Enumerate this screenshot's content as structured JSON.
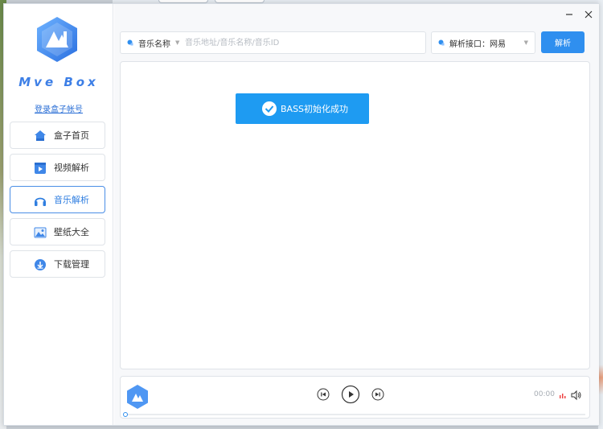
{
  "app": {
    "brand": "Mve Box",
    "login_link": "登录盒子帐号"
  },
  "sidebar": {
    "items": [
      {
        "label": "盒子首页",
        "icon": "home-icon",
        "active": false
      },
      {
        "label": "视频解析",
        "icon": "video-icon",
        "active": false
      },
      {
        "label": "音乐解析",
        "icon": "headphones-icon",
        "active": true
      },
      {
        "label": "壁纸大全",
        "icon": "image-icon",
        "active": false
      },
      {
        "label": "下载管理",
        "icon": "download-icon",
        "active": false
      }
    ]
  },
  "toolbar": {
    "search_type": "音乐名称",
    "search_placeholder": "音乐地址/音乐名称/音乐ID",
    "search_value": "",
    "interface_label": "解析接口：网易",
    "parse_button": "解析"
  },
  "toast": {
    "message": "BASS初始化成功"
  },
  "player": {
    "time": "00:00",
    "progress": 0
  },
  "colors": {
    "accent": "#2f8fef",
    "toast": "#1e9bf2",
    "active_nav": "#4a8ee6"
  }
}
